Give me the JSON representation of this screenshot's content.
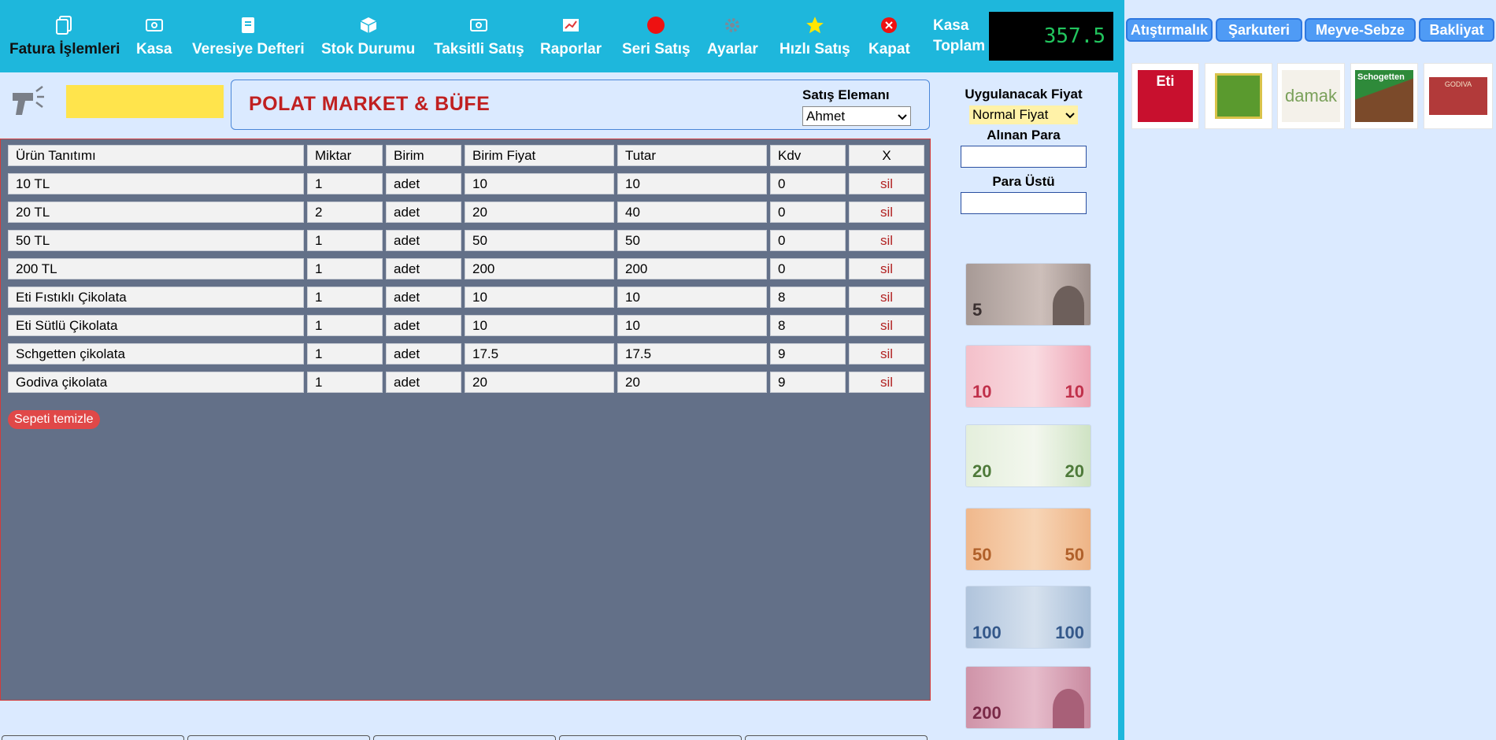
{
  "nav": {
    "items": [
      {
        "label": "Fatura İşlemleri",
        "icon": "documents-icon"
      },
      {
        "label": "Kasa",
        "icon": "money-icon"
      },
      {
        "label": "Veresiye Defteri",
        "icon": "book-icon"
      },
      {
        "label": "Stok Durumu",
        "icon": "box-icon"
      },
      {
        "label": "Taksitli Satış",
        "icon": "money-icon"
      },
      {
        "label": "Raporlar",
        "icon": "chart-icon"
      },
      {
        "label": "Seri Satış",
        "icon": "red-circle-icon"
      },
      {
        "label": "Ayarlar",
        "icon": "gear-icon"
      },
      {
        "label": "Hızlı Satış",
        "icon": "star-icon"
      },
      {
        "label": "Kapat",
        "icon": "close-icon"
      }
    ],
    "kasa_label_1": "Kasa",
    "kasa_label_2": "Toplam",
    "kasa_total": "357.5"
  },
  "store": {
    "name": "POLAT MARKET & BÜFE",
    "seller_label": "Satış Elemanı",
    "seller_value": "Ahmet"
  },
  "cart": {
    "headers": [
      "Ürün Tanıtımı",
      "Miktar",
      "Birim",
      "Birim Fiyat",
      "Tutar",
      "Kdv",
      "X"
    ],
    "rows": [
      [
        "10 TL",
        "1",
        "adet",
        "10",
        "10",
        "0",
        "sil"
      ],
      [
        "20 TL",
        "2",
        "adet",
        "20",
        "40",
        "0",
        "sil"
      ],
      [
        "50 TL",
        "1",
        "adet",
        "50",
        "50",
        "0",
        "sil"
      ],
      [
        "200 TL",
        "1",
        "adet",
        "200",
        "200",
        "0",
        "sil"
      ],
      [
        "Eti Fıstıklı Çikolata",
        "1",
        "adet",
        "10",
        "10",
        "8",
        "sil"
      ],
      [
        "Eti Sütlü Çikolata",
        "1",
        "adet",
        "10",
        "10",
        "8",
        "sil"
      ],
      [
        "Schgetten çikolata",
        "1",
        "adet",
        "17.5",
        "17.5",
        "9",
        "sil"
      ],
      [
        "Godiva çikolata",
        "1",
        "adet",
        "20",
        "20",
        "9",
        "sil"
      ]
    ],
    "clear_label": "Sepeti temizle"
  },
  "payment": {
    "price_label": "Uygulanacak Fiyat",
    "price_value": "Normal Fiyat",
    "received_label": "Alınan Para",
    "change_label": "Para Üstü"
  },
  "banknotes": [
    {
      "value": "5",
      "color": "#b8a9a4"
    },
    {
      "value": "10",
      "color": "#f2b6c2"
    },
    {
      "value": "20",
      "color": "#cfe3c4"
    },
    {
      "value": "50",
      "color": "#f2c49a"
    },
    {
      "value": "100",
      "color": "#b9cbe0"
    },
    {
      "value": "200",
      "color": "#d49ab0"
    }
  ],
  "categories": [
    "Atıştırmalık",
    "Şarkuteri",
    "Meyve-Sebze",
    "Bakliyat"
  ],
  "products": [
    {
      "name": "Eti",
      "color": "#c8102e"
    },
    {
      "name": "",
      "color": "#5a9a2e"
    },
    {
      "name": "damak",
      "color": "#7aa05a"
    },
    {
      "name": "Schogetten",
      "color": "#2e8a3a"
    },
    {
      "name": "GODIVA",
      "color": "#b23a3a"
    }
  ]
}
